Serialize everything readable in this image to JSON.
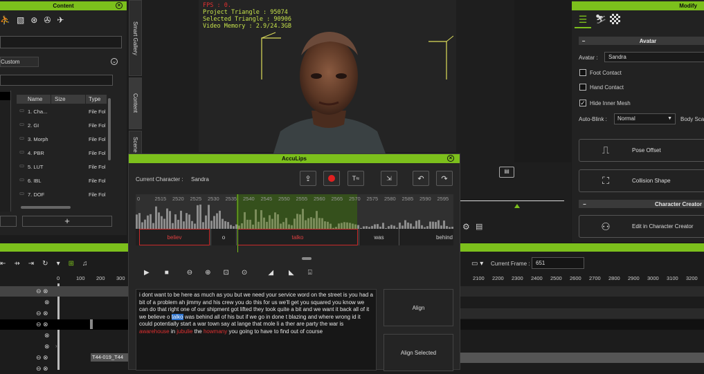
{
  "viewport": {
    "stats": [
      {
        "label": "FPS : 0.",
        "color": "#e03030"
      },
      {
        "label": "Project Triangle : 95074"
      },
      {
        "label": "Selected Triangle : 90906"
      },
      {
        "label": "Video Memory : 2.9/24.3GB"
      }
    ]
  },
  "content_panel": {
    "title": "Content",
    "tab_label": "Custom",
    "columns": [
      "Name",
      "Size",
      "Type"
    ],
    "items": [
      {
        "name": "1. Cha...",
        "type": "File Fol"
      },
      {
        "name": "2. GI",
        "type": "File Fol"
      },
      {
        "name": "3. Morph",
        "type": "File Fol"
      },
      {
        "name": "4. PBR",
        "type": "File Fol"
      },
      {
        "name": "5. LUT",
        "type": "File Fol"
      },
      {
        "name": "6. IBL",
        "type": "File Fol"
      },
      {
        "name": "7. DOF",
        "type": "File Fol"
      }
    ],
    "add_label": "+"
  },
  "side_tabs": [
    "Smart Gallery",
    "Content",
    "Scene"
  ],
  "modify_panel": {
    "title": "Modify",
    "section_avatar": "Avatar",
    "avatar_label": "Avatar :",
    "avatar_value": "Sandra",
    "foot_contact": "Foot Contact",
    "hand_contact": "Hand Contact",
    "hide_inner_mesh": "Hide Inner Mesh",
    "auto_blink_label": "Auto-Blink :",
    "auto_blink_value": "Normal",
    "body_scale": "Body Sca",
    "pose_offset": "Pose Offset",
    "collision_shape": "Collision Shape",
    "section_creator": "Character Creator",
    "edit_in_cc": "Edit in Character Creator"
  },
  "acculips": {
    "title": "AccuLips",
    "current_character_label": "Current Character :",
    "current_character": "Sandra",
    "ruler": [
      "0",
      "2515",
      "2520",
      "2525",
      "2530",
      "2535",
      "2540",
      "2545",
      "2550",
      "2555",
      "2560",
      "2565",
      "2570",
      "2575",
      "2580",
      "2585",
      "2590",
      "2595"
    ],
    "segments": [
      "believ",
      "o",
      "talko",
      "was",
      "behind"
    ],
    "text_parts": [
      {
        "t": "i dont want to be here as much as you but we need your service word on the street is you had a bit of a problem ah jimmy and his crew you do this for us we'll get you squared you know we can do that right one of our shipment got lifted they took quite a bit and we want it back all of it we believe o "
      },
      {
        "t": "talko",
        "hl": true
      },
      {
        "t": " was behind all of his but if we go in done t blazing and where wrong id it could potentially start a war town say at lange that mole li a ther are party the war is "
      },
      {
        "t": "awarehouse",
        "red": true
      },
      {
        "t": " in "
      },
      {
        "t": "jubulie",
        "red": true
      },
      {
        "t": " the "
      },
      {
        "t": "howmany",
        "red": true
      },
      {
        "t": " you going to have to find out of course"
      }
    ],
    "align": "Align",
    "align_selected": "Align Selected"
  },
  "timeline": {
    "ticks_left": [
      "0",
      "100",
      "200",
      "300"
    ],
    "current_frame_label": "Current Frame :",
    "current_frame": "651",
    "ticks_right": [
      "2100",
      "2200",
      "2300",
      "2400",
      "2500",
      "2600",
      "2700",
      "2800",
      "2900",
      "3000",
      "3100",
      "3200"
    ],
    "clip_label": "T44-019_T44"
  },
  "colors": {
    "accent": "#7cc01c",
    "bg": "#1b1b1b",
    "red": "#e03030",
    "highlight": "#2a6fc9"
  }
}
